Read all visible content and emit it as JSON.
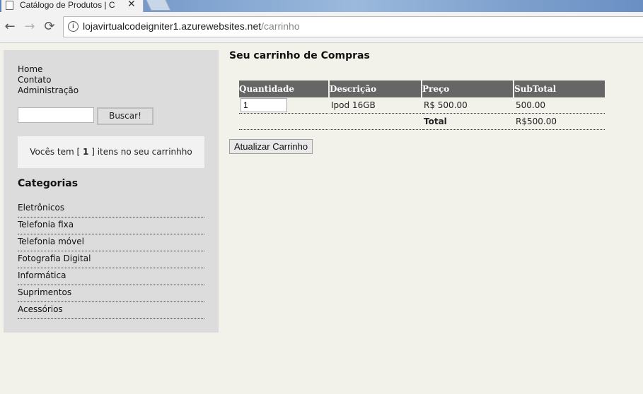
{
  "browser": {
    "tab_title": "Catálogo de Produtos | C",
    "url_host": "lojavirtualcodeigniter1.azurewebsites.net",
    "url_path": "/carrinho"
  },
  "sidebar": {
    "links": [
      "Home",
      "Contato",
      "Administração"
    ],
    "search": {
      "value": "",
      "button_label": "Buscar!"
    },
    "cart_info": {
      "prefix": "Vocês tem [ ",
      "count": "1",
      "suffix": " ] itens no seu carrinhho"
    },
    "categories_title": "Categorias",
    "categories": [
      "Eletrônicos",
      "Telefonia fixa",
      "Telefonia móvel",
      "Fotografia Digital",
      "Informática",
      "Suprimentos",
      "Acessórios"
    ]
  },
  "main": {
    "title": "Seu carrinho de Compras",
    "table": {
      "headers": [
        "Quantidade",
        "Descrição",
        "Preço",
        "SubTotal"
      ],
      "rows": [
        {
          "quantity": "1",
          "description": "Ipod 16GB",
          "price": "R$ 500.00",
          "subtotal": "500.00"
        }
      ],
      "total_label": "Total",
      "total_value": "R$500.00"
    },
    "update_button": "Atualizar Carrinho"
  }
}
